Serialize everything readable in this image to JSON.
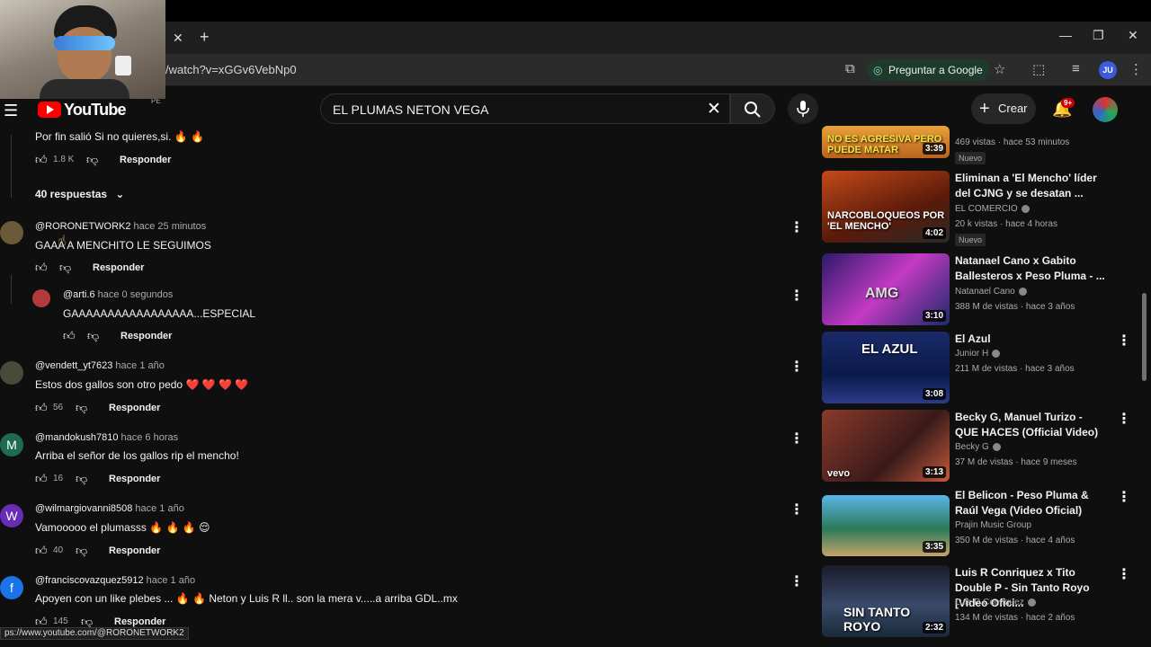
{
  "browser": {
    "url": "/watch?v=xGGv6VebNp0",
    "ask_google": "Preguntar a Google",
    "profile_initials": "JU",
    "status_url": "ps://www.youtube.com/@RORONETWORK2"
  },
  "masthead": {
    "logo_text": "YouTube",
    "country_code": "PE",
    "search_value": "EL PLUMAS NETON VEGA",
    "create_label": "Crear",
    "notif_count": "9+"
  },
  "comments": {
    "top_reply": {
      "text": "Por fin salió Si no quieres,si. 🔥 🔥",
      "likes": "1.8 K",
      "reply_label": "Responder"
    },
    "replies_toggle": "40 respuestas",
    "items": [
      {
        "handle": "@RORONETWORK2",
        "time": "hace 25 minutos",
        "text": "GAAA A MENCHITO LE SEGUIMOS",
        "likes": "",
        "reply_label": "Responder"
      },
      {
        "handle": "@arti.6",
        "time": "hace 0 segundos",
        "text": "GAAAAAAAAAAAAAAAAA...ESPECIAL",
        "likes": "",
        "reply_label": "Responder"
      },
      {
        "handle": "@vendett_yt7623",
        "time": "hace 1 año",
        "text": "Estos dos gallos son otro pedo ❤️ ❤️ ❤️ ❤️",
        "likes": "56",
        "reply_label": "Responder"
      },
      {
        "handle": "@mandokush7810",
        "time": "hace 6 horas",
        "text": "Arriba el señor de los gallos rip el mencho!",
        "likes": "16",
        "reply_label": "Responder",
        "avatar_letter": "M"
      },
      {
        "handle": "@wilmargiovanni8508",
        "time": "hace 1 año",
        "text": "Vamooooo el plumasss 🔥 🔥 🔥 😌",
        "likes": "40",
        "reply_label": "Responder",
        "avatar_letter": "W"
      },
      {
        "handle": "@franciscovazquez5912",
        "time": "hace 1 año",
        "text": "Apoyen con un like plebes ... 🔥 🔥 Neton y Luis R ll.. son la mera v.....a arriba GDL..mx",
        "likes": "145",
        "reply_label": "Responder",
        "avatar_letter": "f"
      }
    ]
  },
  "sidebar": {
    "videos": [
      {
        "thumb_text": "NO ES AGRESIVA PERO PUEDE MATAR",
        "duration": "3:39",
        "title": "",
        "channel": "",
        "meta": "469 vistas · hace 53 minutos",
        "badge": "Nuevo"
      },
      {
        "thumb_text": "NARCOBLOQUEOS POR 'EL MENCHO'",
        "duration": "4:02",
        "title": "Eliminan a 'El Mencho' líder del CJNG y se desatan ...",
        "channel": "EL COMERCIO",
        "meta": "20 k vistas · hace 4 horas",
        "badge": "Nuevo"
      },
      {
        "thumb_text": "AMG",
        "duration": "3:10",
        "title": "Natanael Cano x Gabito Ballesteros x Peso Pluma - ...",
        "channel": "Natanael Cano",
        "meta": "388 M de vistas · hace 3 años",
        "badge": ""
      },
      {
        "thumb_text": "EL AZUL",
        "duration": "3:08",
        "title": "El Azul",
        "channel": "Junior H",
        "meta": "211 M de vistas · hace 3 años",
        "badge": ""
      },
      {
        "thumb_text": "vevo",
        "duration": "3:13",
        "title": "Becky G, Manuel Turizo - QUE HACES (Official Video)",
        "channel": "Becky G",
        "meta": "37 M de vistas · hace 9 meses",
        "badge": ""
      },
      {
        "thumb_text": "",
        "duration": "3:35",
        "title": "El Belicon - Peso Pluma & Raúl Vega (Video Oficial)",
        "channel": "Prajin Music Group",
        "meta": "350 M de vistas · hace 4 años",
        "badge": ""
      },
      {
        "thumb_text": "SIN TANTO ROYO",
        "duration": "2:32",
        "title": "Luis R Conriquez x Tito Double P - Sin Tanto Royo [Video Ofici...",
        "channel": "Luis R Conriquez",
        "meta": "134 M de vistas · hace 2 años",
        "badge": ""
      }
    ]
  },
  "colors": {
    "background": "#0f0f0f",
    "youtube_red": "#ff0000",
    "secondary_text": "#aaaaaa"
  },
  "icons": [
    "close-icon",
    "plus-icon",
    "minimize-icon",
    "restore-icon",
    "star-icon",
    "menu-icon",
    "search-icon",
    "mic-icon",
    "bell-icon",
    "thumbs-up-icon",
    "thumbs-down-icon",
    "more-vert-icon",
    "chevron-down-icon",
    "verified-icon"
  ]
}
